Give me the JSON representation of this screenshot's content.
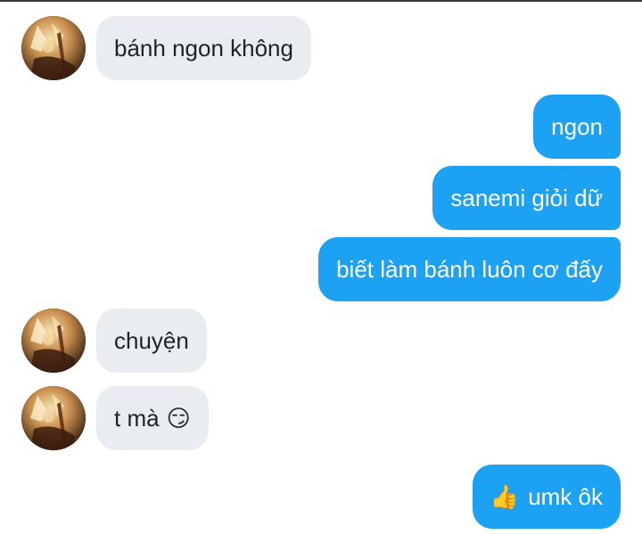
{
  "messages": [
    {
      "id": "m1",
      "side": "incoming",
      "text": "bánh ngon không"
    },
    {
      "id": "m2",
      "side": "outgoing",
      "text": "ngon"
    },
    {
      "id": "m3",
      "side": "outgoing",
      "text": "sanemi giỏi dữ"
    },
    {
      "id": "m4",
      "side": "outgoing",
      "text": "biết làm bánh luôn cơ đấy"
    },
    {
      "id": "m5",
      "side": "incoming",
      "text": "chuyện"
    },
    {
      "id": "m6",
      "side": "incoming",
      "text": "t mà",
      "emoji": "😏"
    },
    {
      "id": "m7",
      "side": "outgoing",
      "text": "umk ôk",
      "emoji_lead": "👍"
    }
  ],
  "colors": {
    "outgoing_bubble": "#1da1f2",
    "incoming_bubble": "#e9edf1",
    "incoming_text": "#1f2226",
    "outgoing_text": "#ffffff"
  },
  "icons": {
    "avatar": "contact-avatar-image"
  }
}
